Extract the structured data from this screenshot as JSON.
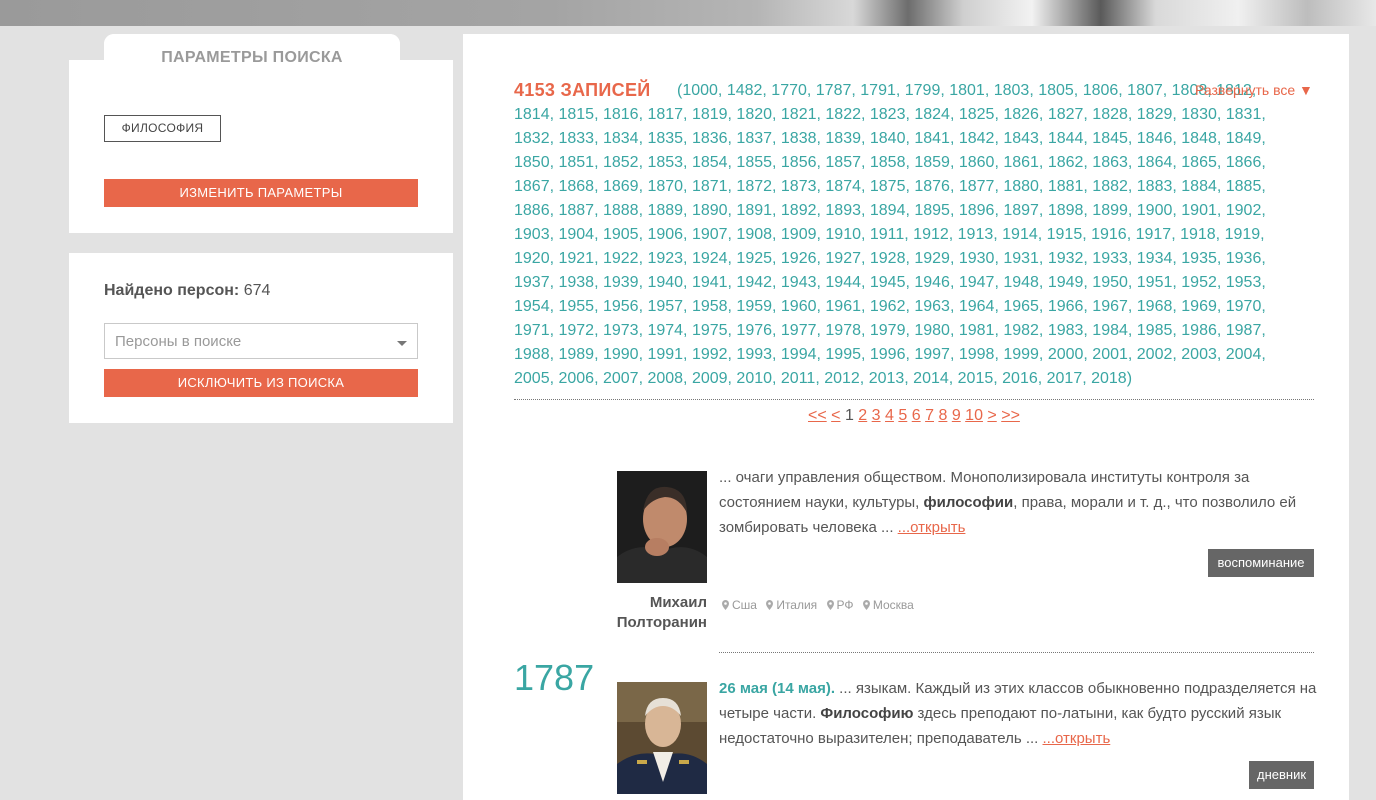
{
  "sidebar": {
    "tab_title": "ПАРАМЕТРЫ ПОИСКА",
    "tag": "ФИЛОСОФИЯ",
    "change_button": "ИЗМЕНИТЬ ПАРАМЕТРЫ",
    "found_label": "Найдено персон:",
    "found_count": "674",
    "persons_placeholder": "Персоны в поиске",
    "exclude_button": "ИСКЛЮЧИТЬ ИЗ ПОИСКА"
  },
  "results": {
    "count_label": "4153 ЗАПИСЕЙ",
    "years_text": "(1000, 1482, 1770, 1787, 1791, 1799, 1801, 1803, 1805, 1806, 1807, 1808, 1812, 1814, 1815, 1816, 1817, 1819, 1820, 1821, 1822, 1823, 1824, 1825, 1826, 1827, 1828, 1829, 1830, 1831, 1832, 1833, 1834, 1835, 1836, 1837, 1838, 1839, 1840, 1841, 1842, 1843, 1844, 1845, 1846, 1848, 1849, 1850, 1851, 1852, 1853, 1854, 1855, 1856, 1857, 1858, 1859, 1860, 1861, 1862, 1863, 1864, 1865, 1866, 1867, 1868, 1869, 1870, 1871, 1872, 1873, 1874, 1875, 1876, 1877, 1880, 1881, 1882, 1883, 1884, 1885, 1886, 1887, 1888, 1889, 1890, 1891, 1892, 1893, 1894, 1895, 1896, 1897, 1898, 1899, 1900, 1901, 1902, 1903, 1904, 1905, 1906, 1907, 1908, 1909, 1910, 1911, 1912, 1913, 1914, 1915, 1916, 1917, 1918, 1919, 1920, 1921, 1922, 1923, 1924, 1925, 1926, 1927, 1928, 1929, 1930, 1931, 1932, 1933, 1934, 1935, 1936, 1937, 1938, 1939, 1940, 1941, 1942, 1943, 1944, 1945, 1946, 1947, 1948, 1949, 1950, 1951, 1952, 1953, 1954, 1955, 1956, 1957, 1958, 1959, 1960, 1961, 1962, 1963, 1964, 1965, 1966, 1967, 1968, 1969, 1970, 1971, 1972, 1973, 1974, 1975, 1976, 1977, 1978, 1979, 1980, 1981, 1982, 1983, 1984, 1985, 1986, 1987, 1988, 1989, 1990, 1991, 1992, 1993, 1994, 1995, 1996, 1997, 1998, 1999, 2000, 2001, 2002, 2003, 2004, 2005, 2006, 2007, 2008, 2009, 2010, 2011, 2012, 2013, 2014, 2015, 2016, 2017, 2018)",
    "expand_label": "Развернуть все ▼"
  },
  "pager": {
    "first": "<<",
    "prev": "<",
    "current": "1",
    "pages": [
      "2",
      "3",
      "4",
      "5",
      "6",
      "7",
      "8",
      "9",
      "10"
    ],
    "next": ">",
    "last": ">>"
  },
  "entries": [
    {
      "year": "",
      "person_first": "Михаил",
      "person_last": "Полторанин",
      "text_before": "... очаги управления обществом. Монополизировала институты контроля за состоянием науки, культуры, ",
      "highlight": "философии",
      "text_after": ", права, морали и т. д., что позволило ей зомбировать человека ... ",
      "open_link": "...открыть",
      "badge": "воспоминание",
      "places": [
        "Сша",
        "Италия",
        "РФ",
        "Москва"
      ]
    },
    {
      "year": "1787",
      "date": "26 мая (14 мая).",
      "text_before": "  ... языкам. Каждый из этих классов обыкновенно подразделяется на четыре части. ",
      "highlight": "Философию",
      "text_after": " здесь преподают по-латыни, как будто русский язык недостаточно выразителен; преподаватель ... ",
      "open_link": "...открыть",
      "badge": "дневник"
    }
  ],
  "colors": {
    "accent_orange": "#e8674a",
    "accent_teal": "#3aa6a3",
    "badge_gray": "#666666"
  }
}
